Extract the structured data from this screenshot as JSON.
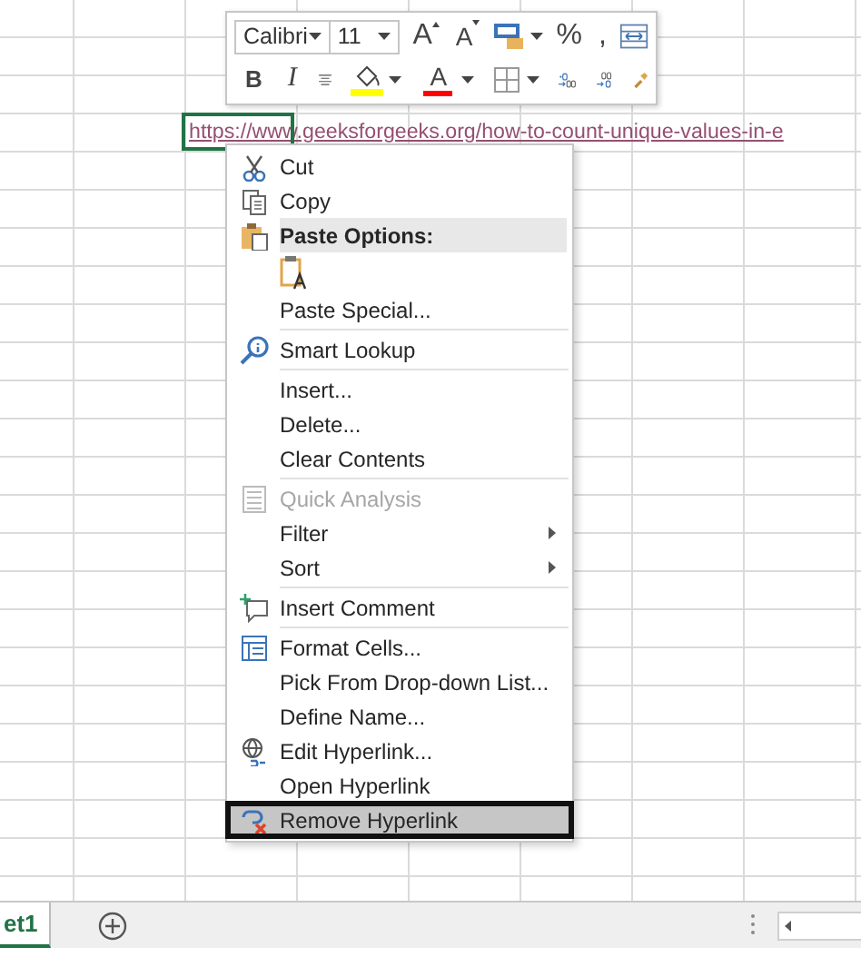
{
  "sheet": {
    "cell_link": "https://www.geeksforgeeks.org/how-to-count-unique-values-in-e"
  },
  "mini_toolbar": {
    "font": "Calibri",
    "size": "11",
    "row1": [
      {
        "kind": "grow",
        "label": "A"
      },
      {
        "kind": "shrink",
        "label": "A"
      },
      {
        "kind": "styles"
      },
      {
        "kind": "char",
        "label": "%"
      },
      {
        "kind": "char",
        "label": ","
      },
      {
        "kind": "merge"
      }
    ],
    "row2": [
      {
        "kind": "bold",
        "label": "B"
      },
      {
        "kind": "italic",
        "label": "I"
      },
      {
        "kind": "center"
      },
      {
        "kind": "fill",
        "color": "#ffff00"
      },
      {
        "kind": "font-color",
        "label": "A",
        "color": "#ff0000"
      },
      {
        "kind": "borders"
      },
      {
        "kind": "inc-decimal"
      },
      {
        "kind": "dec-decimal"
      },
      {
        "kind": "painter"
      }
    ]
  },
  "menu": {
    "sections": [
      [
        {
          "kind": "command",
          "label": "Cut",
          "disabled": false,
          "submenu": false,
          "selected": false
        },
        {
          "kind": "command",
          "label": "Copy",
          "disabled": false,
          "submenu": false,
          "selected": false
        },
        {
          "kind": "header",
          "label": "Paste Options:"
        },
        {
          "kind": "paste-option"
        },
        {
          "kind": "command",
          "label": "Paste Special...",
          "disabled": false,
          "submenu": false,
          "selected": false
        }
      ],
      [
        {
          "kind": "command",
          "label": "Smart Lookup",
          "disabled": false,
          "submenu": false,
          "selected": false
        }
      ],
      [
        {
          "kind": "command",
          "label": "Insert...",
          "disabled": false,
          "submenu": false,
          "selected": false
        },
        {
          "kind": "command",
          "label": "Delete...",
          "disabled": false,
          "submenu": false,
          "selected": false
        },
        {
          "kind": "command",
          "label": "Clear Contents",
          "disabled": false,
          "submenu": false,
          "selected": false
        }
      ],
      [
        {
          "kind": "command",
          "label": "Quick Analysis",
          "disabled": true,
          "submenu": false,
          "selected": false
        },
        {
          "kind": "command",
          "label": "Filter",
          "disabled": false,
          "submenu": true,
          "selected": false
        },
        {
          "kind": "command",
          "label": "Sort",
          "disabled": false,
          "submenu": true,
          "selected": false
        }
      ],
      [
        {
          "kind": "command",
          "label": "Insert Comment",
          "disabled": false,
          "submenu": false,
          "selected": false
        }
      ],
      [
        {
          "kind": "command",
          "label": "Format Cells...",
          "disabled": false,
          "submenu": false,
          "selected": false
        },
        {
          "kind": "command",
          "label": "Pick From Drop-down List...",
          "disabled": false,
          "submenu": false,
          "selected": false
        },
        {
          "kind": "command",
          "label": "Define Name...",
          "disabled": false,
          "submenu": false,
          "selected": false
        },
        {
          "kind": "command",
          "label": "Edit Hyperlink...",
          "disabled": false,
          "submenu": false,
          "selected": false
        },
        {
          "kind": "command",
          "label": "Open Hyperlink",
          "disabled": false,
          "submenu": false,
          "selected": false
        },
        {
          "kind": "command",
          "label": "Remove Hyperlink",
          "disabled": false,
          "submenu": false,
          "selected": true
        }
      ]
    ]
  },
  "sheet_tabs": [
    {
      "label": "et1",
      "selected": true
    }
  ]
}
